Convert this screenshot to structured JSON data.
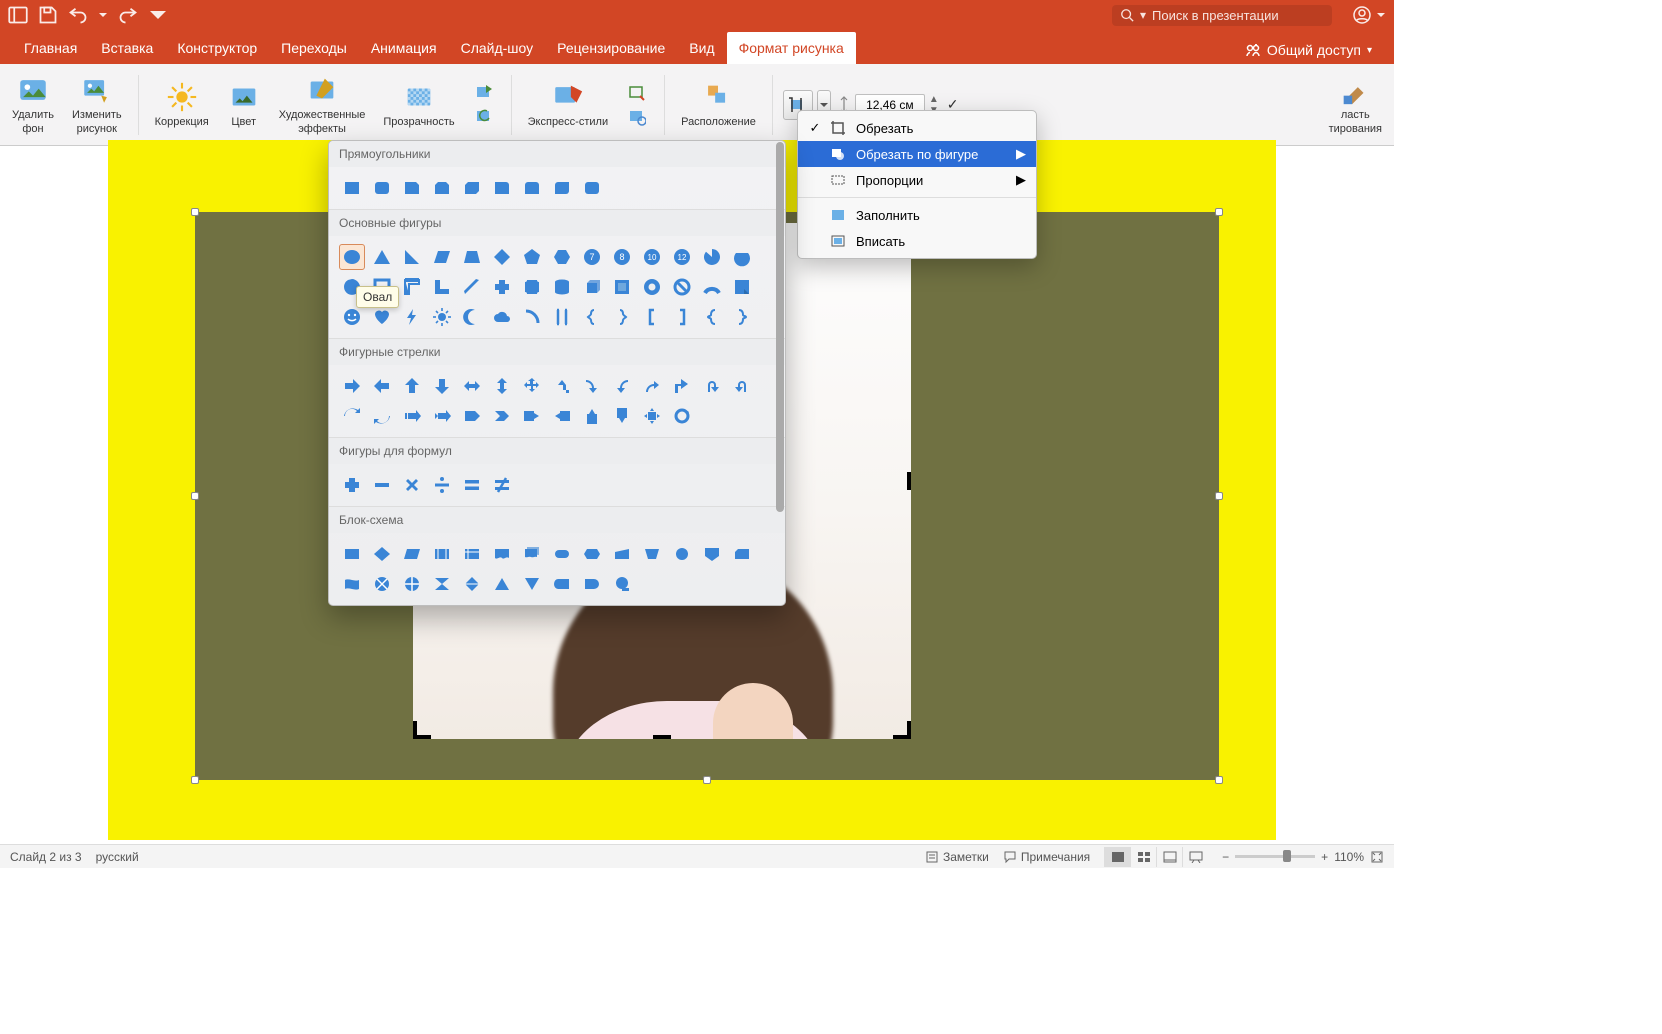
{
  "app": {
    "search_placeholder": "Поиск в презентации"
  },
  "tabs": [
    "Главная",
    "Вставка",
    "Конструктор",
    "Переходы",
    "Анимация",
    "Слайд-шоу",
    "Рецензирование",
    "Вид",
    "Формат рисунка"
  ],
  "active_tab": "Формат рисунка",
  "share_label": "Общий доступ",
  "ribbon": {
    "remove_bg": "Удалить\nфон",
    "change_picture": "Изменить\nрисунок",
    "corrections": "Коррекция",
    "color": "Цвет",
    "artistic": "Художественные\nэффекты",
    "transparency": "Прозрачность",
    "express_styles": "Экспресс-стили",
    "position": "Расположение",
    "crop_area": "ласть\nтирования",
    "height": "12,46 см"
  },
  "crop_menu": {
    "crop": "Обрезать",
    "crop_to_shape": "Обрезать по фигуре",
    "proportions": "Пропорции",
    "fill": "Заполнить",
    "fit": "Вписать"
  },
  "shapes_panel": {
    "tooltip": "Овал",
    "sections": {
      "rectangles": "Прямоугольники",
      "basic": "Основные фигуры",
      "arrows": "Фигурные стрелки",
      "formulas": "Фигуры для формул",
      "flowchart": "Блок-схема"
    },
    "rectangle_items": [
      "rect",
      "rounded",
      "snip1",
      "snip2",
      "snip-diag",
      "round1",
      "round2",
      "round-diag",
      "round-same"
    ],
    "basic_items_row1": [
      "oval",
      "triangle",
      "rt-triangle",
      "parallelogram",
      "trapezoid",
      "diamond",
      "pentagon",
      "hexagon",
      "heptagon",
      "regular8",
      "regular10",
      "regular12"
    ],
    "basic_items_row2": [
      "pie",
      "chord",
      "teardrop",
      "frame",
      "half-frame",
      "l-shape",
      "diag-stripe",
      "plus",
      "plaque",
      "can",
      "cube",
      "bevel"
    ],
    "basic_items_row3": [
      "donut",
      "no-symbol",
      "arc",
      "folded",
      "smiley",
      "heart",
      "lightning",
      "sun",
      "moon",
      "cloud",
      "arc2",
      "dbl-bracket"
    ],
    "basic_items_row4": [
      "left-brace",
      "right-brace",
      "left-bracket",
      "right-bracket",
      "brace-l",
      "brace-r"
    ],
    "arrows_row1": [
      "right",
      "left",
      "up",
      "down",
      "leftright",
      "updown",
      "quad",
      "bent",
      "curved-r",
      "curved-l",
      "curved-u",
      "curved-d"
    ],
    "arrows_row2": [
      "uturn-l",
      "uturn-r",
      "cycle",
      "ccycle",
      "striped",
      "notched",
      "pentagon-a",
      "chevron",
      "callout-r",
      "callout-l",
      "callout-u",
      "callout-d"
    ],
    "arrows_row3": [
      "quad-callout",
      "circular"
    ],
    "formulas": [
      "plus",
      "minus",
      "multiply",
      "divide",
      "equals",
      "notequal"
    ],
    "flow_row1": [
      "process",
      "decision",
      "data",
      "predef",
      "internal",
      "document",
      "multidoc",
      "terminator",
      "preparation",
      "manual-in",
      "manual-op",
      "connector"
    ],
    "flow_row2": [
      "offpage",
      "card",
      "punched",
      "summing",
      "or",
      "collate",
      "sort",
      "extract",
      "merge",
      "stored",
      "delay",
      "seq-access"
    ]
  },
  "statusbar": {
    "slide": "Слайд 2 из 3",
    "lang": "русский",
    "notes": "Заметки",
    "comments": "Примечания",
    "zoom": "110%"
  }
}
